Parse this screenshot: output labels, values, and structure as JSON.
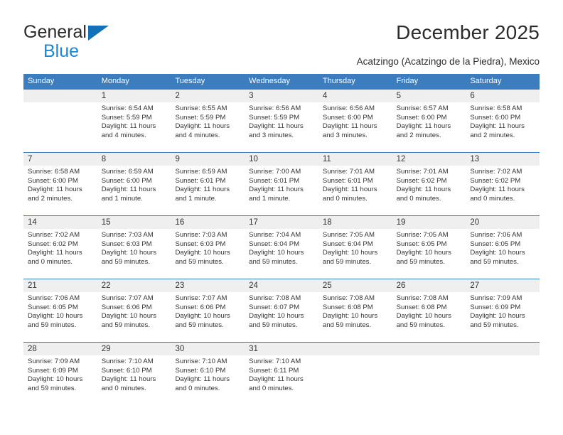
{
  "brand": {
    "word1": "General",
    "word2": "Blue",
    "triangle_color": "#1271b8",
    "word2_color": "#1b86d6"
  },
  "header": {
    "title": "December 2025",
    "subtitle": "Acatzingo (Acatzingo de la Piedra), Mexico"
  },
  "colors": {
    "header_blue": "#3b7dbf",
    "daynum_band": "#efefef",
    "text": "#333333"
  },
  "calendar": {
    "weekdays": [
      "Sunday",
      "Monday",
      "Tuesday",
      "Wednesday",
      "Thursday",
      "Friday",
      "Saturday"
    ],
    "weeks": [
      [
        {
          "day": "",
          "sunrise": "",
          "sunset": "",
          "daylight": ""
        },
        {
          "day": "1",
          "sunrise": "Sunrise: 6:54 AM",
          "sunset": "Sunset: 5:59 PM",
          "daylight": "Daylight: 11 hours and 4 minutes."
        },
        {
          "day": "2",
          "sunrise": "Sunrise: 6:55 AM",
          "sunset": "Sunset: 5:59 PM",
          "daylight": "Daylight: 11 hours and 4 minutes."
        },
        {
          "day": "3",
          "sunrise": "Sunrise: 6:56 AM",
          "sunset": "Sunset: 5:59 PM",
          "daylight": "Daylight: 11 hours and 3 minutes."
        },
        {
          "day": "4",
          "sunrise": "Sunrise: 6:56 AM",
          "sunset": "Sunset: 6:00 PM",
          "daylight": "Daylight: 11 hours and 3 minutes."
        },
        {
          "day": "5",
          "sunrise": "Sunrise: 6:57 AM",
          "sunset": "Sunset: 6:00 PM",
          "daylight": "Daylight: 11 hours and 2 minutes."
        },
        {
          "day": "6",
          "sunrise": "Sunrise: 6:58 AM",
          "sunset": "Sunset: 6:00 PM",
          "daylight": "Daylight: 11 hours and 2 minutes."
        }
      ],
      [
        {
          "day": "7",
          "sunrise": "Sunrise: 6:58 AM",
          "sunset": "Sunset: 6:00 PM",
          "daylight": "Daylight: 11 hours and 2 minutes."
        },
        {
          "day": "8",
          "sunrise": "Sunrise: 6:59 AM",
          "sunset": "Sunset: 6:00 PM",
          "daylight": "Daylight: 11 hours and 1 minute."
        },
        {
          "day": "9",
          "sunrise": "Sunrise: 6:59 AM",
          "sunset": "Sunset: 6:01 PM",
          "daylight": "Daylight: 11 hours and 1 minute."
        },
        {
          "day": "10",
          "sunrise": "Sunrise: 7:00 AM",
          "sunset": "Sunset: 6:01 PM",
          "daylight": "Daylight: 11 hours and 1 minute."
        },
        {
          "day": "11",
          "sunrise": "Sunrise: 7:01 AM",
          "sunset": "Sunset: 6:01 PM",
          "daylight": "Daylight: 11 hours and 0 minutes."
        },
        {
          "day": "12",
          "sunrise": "Sunrise: 7:01 AM",
          "sunset": "Sunset: 6:02 PM",
          "daylight": "Daylight: 11 hours and 0 minutes."
        },
        {
          "day": "13",
          "sunrise": "Sunrise: 7:02 AM",
          "sunset": "Sunset: 6:02 PM",
          "daylight": "Daylight: 11 hours and 0 minutes."
        }
      ],
      [
        {
          "day": "14",
          "sunrise": "Sunrise: 7:02 AM",
          "sunset": "Sunset: 6:02 PM",
          "daylight": "Daylight: 11 hours and 0 minutes."
        },
        {
          "day": "15",
          "sunrise": "Sunrise: 7:03 AM",
          "sunset": "Sunset: 6:03 PM",
          "daylight": "Daylight: 10 hours and 59 minutes."
        },
        {
          "day": "16",
          "sunrise": "Sunrise: 7:03 AM",
          "sunset": "Sunset: 6:03 PM",
          "daylight": "Daylight: 10 hours and 59 minutes."
        },
        {
          "day": "17",
          "sunrise": "Sunrise: 7:04 AM",
          "sunset": "Sunset: 6:04 PM",
          "daylight": "Daylight: 10 hours and 59 minutes."
        },
        {
          "day": "18",
          "sunrise": "Sunrise: 7:05 AM",
          "sunset": "Sunset: 6:04 PM",
          "daylight": "Daylight: 10 hours and 59 minutes."
        },
        {
          "day": "19",
          "sunrise": "Sunrise: 7:05 AM",
          "sunset": "Sunset: 6:05 PM",
          "daylight": "Daylight: 10 hours and 59 minutes."
        },
        {
          "day": "20",
          "sunrise": "Sunrise: 7:06 AM",
          "sunset": "Sunset: 6:05 PM",
          "daylight": "Daylight: 10 hours and 59 minutes."
        }
      ],
      [
        {
          "day": "21",
          "sunrise": "Sunrise: 7:06 AM",
          "sunset": "Sunset: 6:05 PM",
          "daylight": "Daylight: 10 hours and 59 minutes."
        },
        {
          "day": "22",
          "sunrise": "Sunrise: 7:07 AM",
          "sunset": "Sunset: 6:06 PM",
          "daylight": "Daylight: 10 hours and 59 minutes."
        },
        {
          "day": "23",
          "sunrise": "Sunrise: 7:07 AM",
          "sunset": "Sunset: 6:06 PM",
          "daylight": "Daylight: 10 hours and 59 minutes."
        },
        {
          "day": "24",
          "sunrise": "Sunrise: 7:08 AM",
          "sunset": "Sunset: 6:07 PM",
          "daylight": "Daylight: 10 hours and 59 minutes."
        },
        {
          "day": "25",
          "sunrise": "Sunrise: 7:08 AM",
          "sunset": "Sunset: 6:08 PM",
          "daylight": "Daylight: 10 hours and 59 minutes."
        },
        {
          "day": "26",
          "sunrise": "Sunrise: 7:08 AM",
          "sunset": "Sunset: 6:08 PM",
          "daylight": "Daylight: 10 hours and 59 minutes."
        },
        {
          "day": "27",
          "sunrise": "Sunrise: 7:09 AM",
          "sunset": "Sunset: 6:09 PM",
          "daylight": "Daylight: 10 hours and 59 minutes."
        }
      ],
      [
        {
          "day": "28",
          "sunrise": "Sunrise: 7:09 AM",
          "sunset": "Sunset: 6:09 PM",
          "daylight": "Daylight: 10 hours and 59 minutes."
        },
        {
          "day": "29",
          "sunrise": "Sunrise: 7:10 AM",
          "sunset": "Sunset: 6:10 PM",
          "daylight": "Daylight: 11 hours and 0 minutes."
        },
        {
          "day": "30",
          "sunrise": "Sunrise: 7:10 AM",
          "sunset": "Sunset: 6:10 PM",
          "daylight": "Daylight: 11 hours and 0 minutes."
        },
        {
          "day": "31",
          "sunrise": "Sunrise: 7:10 AM",
          "sunset": "Sunset: 6:11 PM",
          "daylight": "Daylight: 11 hours and 0 minutes."
        },
        {
          "day": "",
          "sunrise": "",
          "sunset": "",
          "daylight": ""
        },
        {
          "day": "",
          "sunrise": "",
          "sunset": "",
          "daylight": ""
        },
        {
          "day": "",
          "sunrise": "",
          "sunset": "",
          "daylight": ""
        }
      ]
    ]
  }
}
